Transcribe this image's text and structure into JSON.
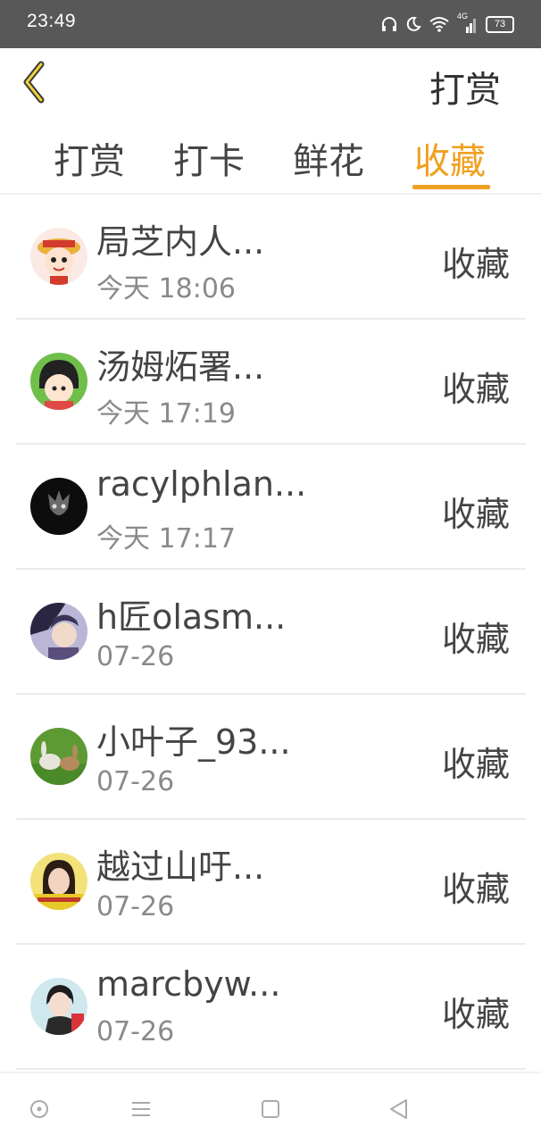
{
  "status_bar": {
    "time": "23:49",
    "battery": "73",
    "network": "4G",
    "icons": [
      "headphones-icon",
      "moon-icon",
      "wifi-icon",
      "signal-icon",
      "battery-icon"
    ]
  },
  "header": {
    "back_icon": "chevron-left-icon",
    "action_label": "打赏"
  },
  "tabs": [
    {
      "label": "打赏",
      "active": false
    },
    {
      "label": "打卡",
      "active": false
    },
    {
      "label": "鲜花",
      "active": false
    },
    {
      "label": "收藏",
      "active": true
    }
  ],
  "list": [
    {
      "name": "局芝内人...",
      "time": "今天 18:06",
      "action": "收藏"
    },
    {
      "name": "汤姆炻署...",
      "time": "今天 17:19",
      "action": "收藏"
    },
    {
      "name": "racylphlan...",
      "time": "今天 17:17",
      "action": "收藏"
    },
    {
      "name": "h匠olasm...",
      "time": "07-26",
      "action": "收藏"
    },
    {
      "name": "小叶子_93...",
      "time": "07-26",
      "action": "收藏"
    },
    {
      "name": "越过山吁...",
      "time": "07-26",
      "action": "收藏"
    },
    {
      "name": "marcbyw...",
      "time": "07-26",
      "action": "收藏"
    }
  ],
  "nav_bar": {
    "icons": [
      "circle-dot-icon",
      "menu-icon",
      "square-icon",
      "back-triangle-icon"
    ]
  },
  "colors": {
    "accent": "#f0a020",
    "status_bar": "#585858",
    "text_primary": "#444444",
    "text_secondary": "#8a8a8a"
  }
}
